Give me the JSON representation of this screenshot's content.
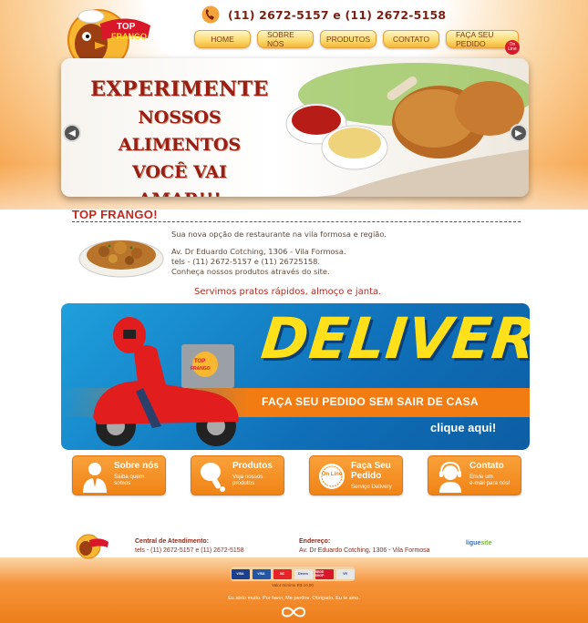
{
  "header": {
    "logo_alt": "TOP FRANGO",
    "phone": "(11) 2672-5157 e (11) 2672-5158",
    "nav": [
      "HOME",
      "SOBRE NÓS",
      "PRODUTOS",
      "CONTATO",
      "FAÇA SEU PEDIDO"
    ],
    "online_badge": "On Line"
  },
  "slider": {
    "line1": "EXPERIMENTE",
    "line2": "NOSSOS ALIMENTOS",
    "line3": "VOCÊ VAI AMAR!!!",
    "prev_icon": "arrow-left-icon",
    "next_icon": "arrow-right-icon"
  },
  "intro": {
    "title": "TOP FRANGO!",
    "tagline": "Sua nova opção de restaurante na vila formosa e região.",
    "address": "Av. Dr Eduardo Cotching, 1306 - Vila Formosa.",
    "phones": "tels - (11) 2672-5157 e (11) 26725158.",
    "products": "Conheça nossos produtos através do site.",
    "served": "Servimos pratos rápidos, almoço e janta."
  },
  "delivery": {
    "title": "DELIVERY",
    "subtitle": "FAÇA SEU PEDIDO SEM SAIR DE CASA",
    "cta": "clique aqui!",
    "box_logo": "TOP FRANGO"
  },
  "cards": [
    {
      "title": "Sobre nós",
      "title2": "",
      "sub1": "Saiba quem",
      "sub2": "somos",
      "icon": "person-icon"
    },
    {
      "title": "Produtos",
      "title2": "",
      "sub1": "Veja nossos",
      "sub2": "produtos",
      "icon": "chicken-leg-icon"
    },
    {
      "title": "Faça Seu",
      "title2": "Pedido",
      "sub1": "Serviço Delivery",
      "sub2": "",
      "icon": "online-seal-icon",
      "seal": "On Line"
    },
    {
      "title": "Contato",
      "title2": "",
      "sub1": "Envie um",
      "sub2": "e-mail para nós!",
      "icon": "headset-icon"
    }
  ],
  "footer": {
    "central_label": "Central de Atendimento:",
    "central_value": "tels - (11) 2672-5157 e (11) 2672-5158",
    "address_label": "Endereço:",
    "address_value": "Av. Dr Eduardo Cotching, 1306 - Vila Formosa",
    "agency_a": "ligue",
    "agency_b": "site",
    "payments": [
      "VISA",
      "VISA",
      "MC",
      "Diners",
      "REDE SHOP",
      "VR"
    ],
    "min_value": "Valor mínimo R$ 10,00",
    "motto": "Eu sinto muito. Por favor, Me perdoe. Obrigado. Eu te amo."
  }
}
